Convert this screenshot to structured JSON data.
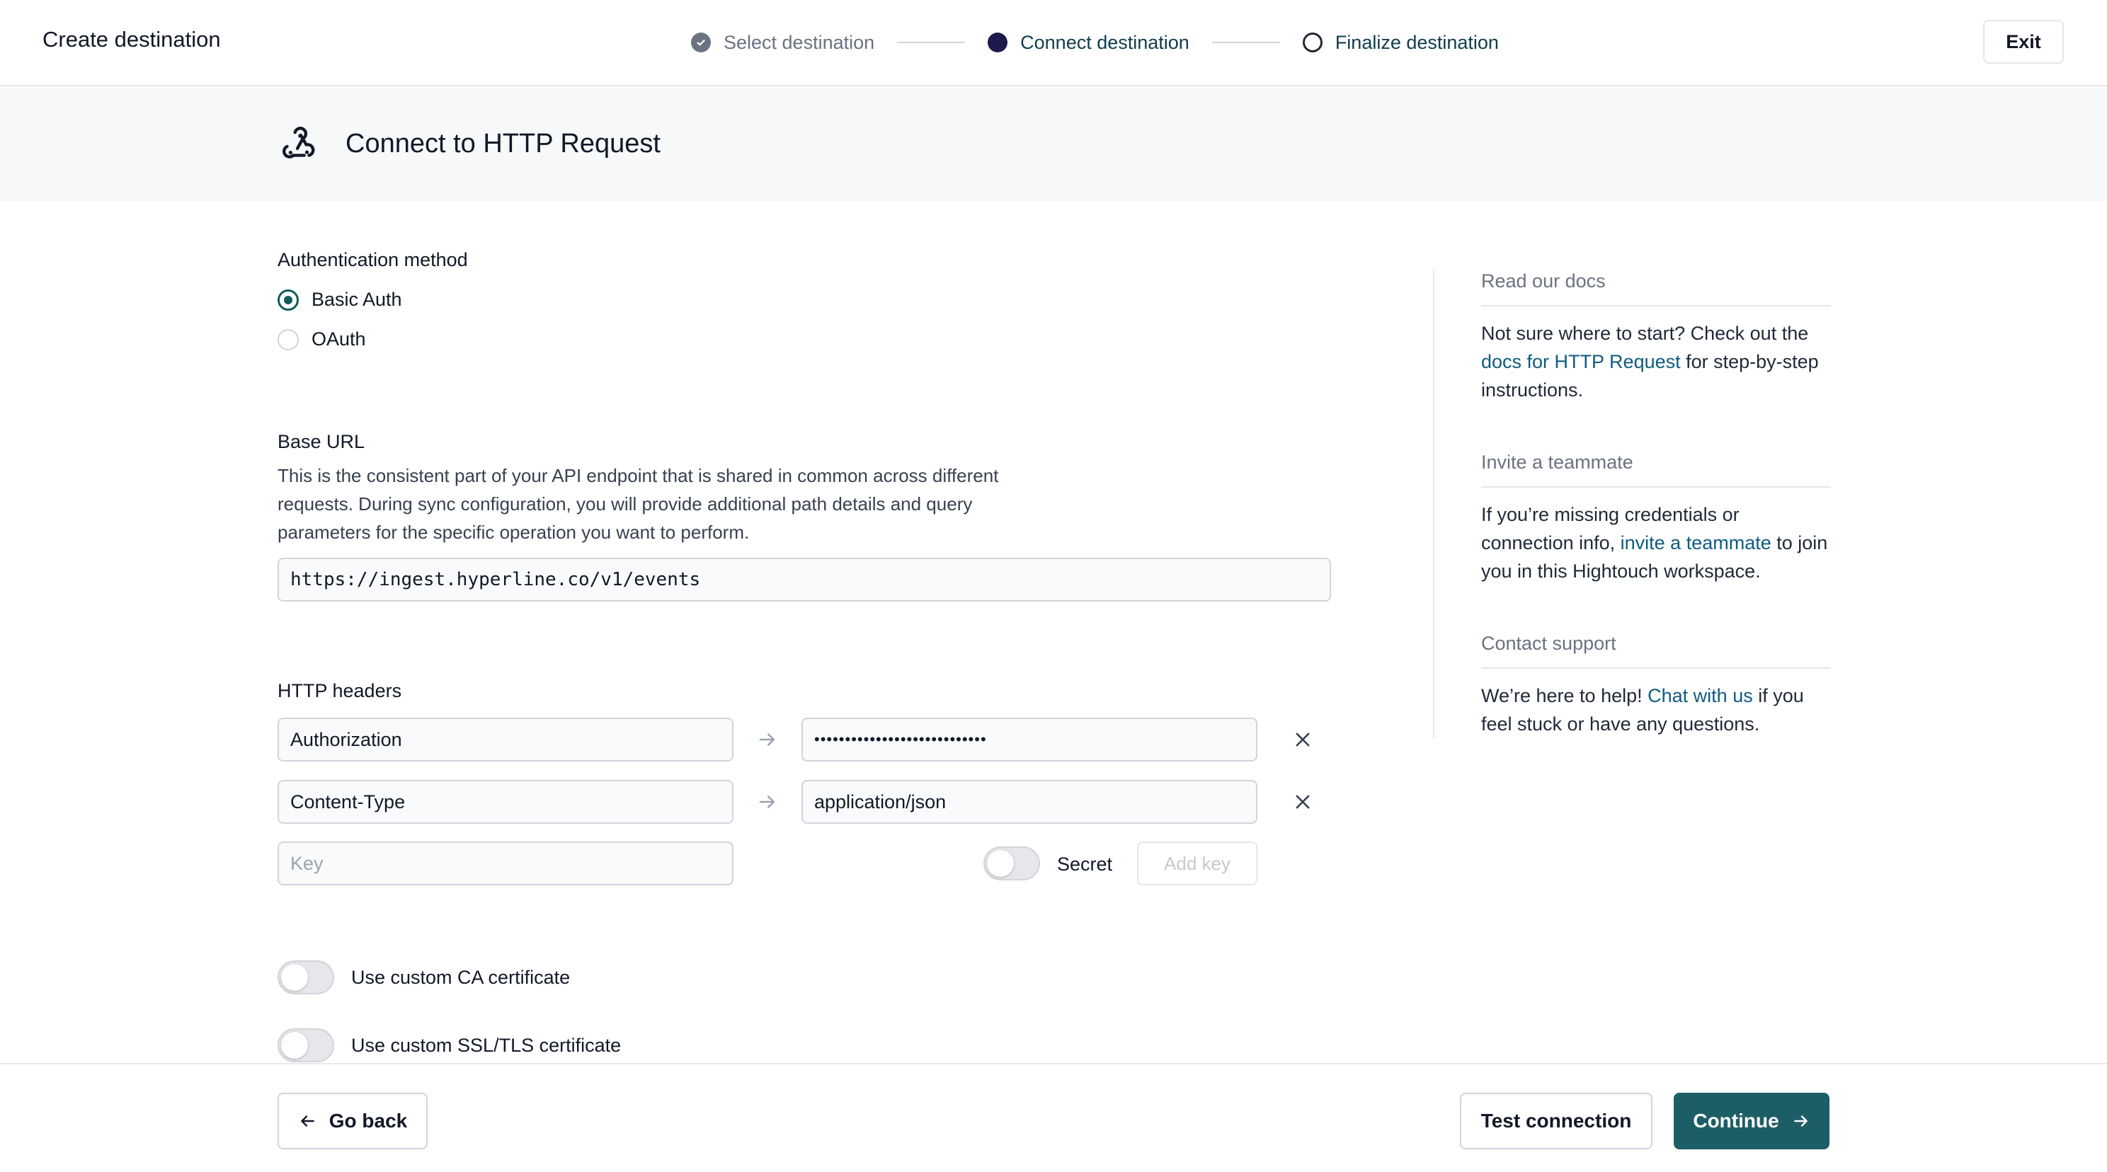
{
  "header": {
    "title": "Create destination",
    "steps": [
      {
        "label": "Select destination",
        "state": "done"
      },
      {
        "label": "Connect destination",
        "state": "active"
      },
      {
        "label": "Finalize destination",
        "state": "upcoming"
      }
    ],
    "exit_label": "Exit"
  },
  "connect": {
    "title": "Connect to HTTP Request",
    "icon": "webhook-icon"
  },
  "auth": {
    "label": "Authentication method",
    "options": [
      {
        "label": "Basic Auth",
        "selected": true
      },
      {
        "label": "OAuth",
        "selected": false
      }
    ]
  },
  "base_url": {
    "label": "Base URL",
    "description": "This is the consistent part of your API endpoint that is shared in common across different requests. During sync configuration, you will provide additional path details and query parameters for the specific operation you want to perform.",
    "value": "https://ingest.hyperline.co/v1/events"
  },
  "headers": {
    "label": "HTTP headers",
    "rows": [
      {
        "key": "Authorization",
        "value": "••••••••••••••••••••••••••••"
      },
      {
        "key": "Content-Type",
        "value": "application/json"
      }
    ],
    "new_key_placeholder": "Key",
    "secret_label": "Secret",
    "add_key_label": "Add key"
  },
  "options": {
    "ca_label": "Use custom CA certificate",
    "ssl_label": "Use custom SSL/TLS certificate"
  },
  "sidebar": {
    "docs": {
      "title": "Read our docs",
      "text_before": "Not sure where to start? Check out the ",
      "link": "docs for HTTP Request",
      "text_after": " for step-by-step instructions."
    },
    "invite": {
      "title": "Invite a teammate",
      "text_before": "If you’re missing credentials or connection info, ",
      "link": "invite a teammate",
      "text_after": " to join you in this Hightouch workspace."
    },
    "support": {
      "title": "Contact support",
      "text_before": "We’re here to help! ",
      "link": "Chat with us",
      "text_after": " if you feel stuck or have any questions."
    }
  },
  "footer": {
    "back_label": "Go back",
    "test_label": "Test connection",
    "continue_label": "Continue"
  },
  "colors": {
    "accent": "#1d5e66",
    "link": "#0f5c80",
    "active_step": "#1e1b4b"
  }
}
